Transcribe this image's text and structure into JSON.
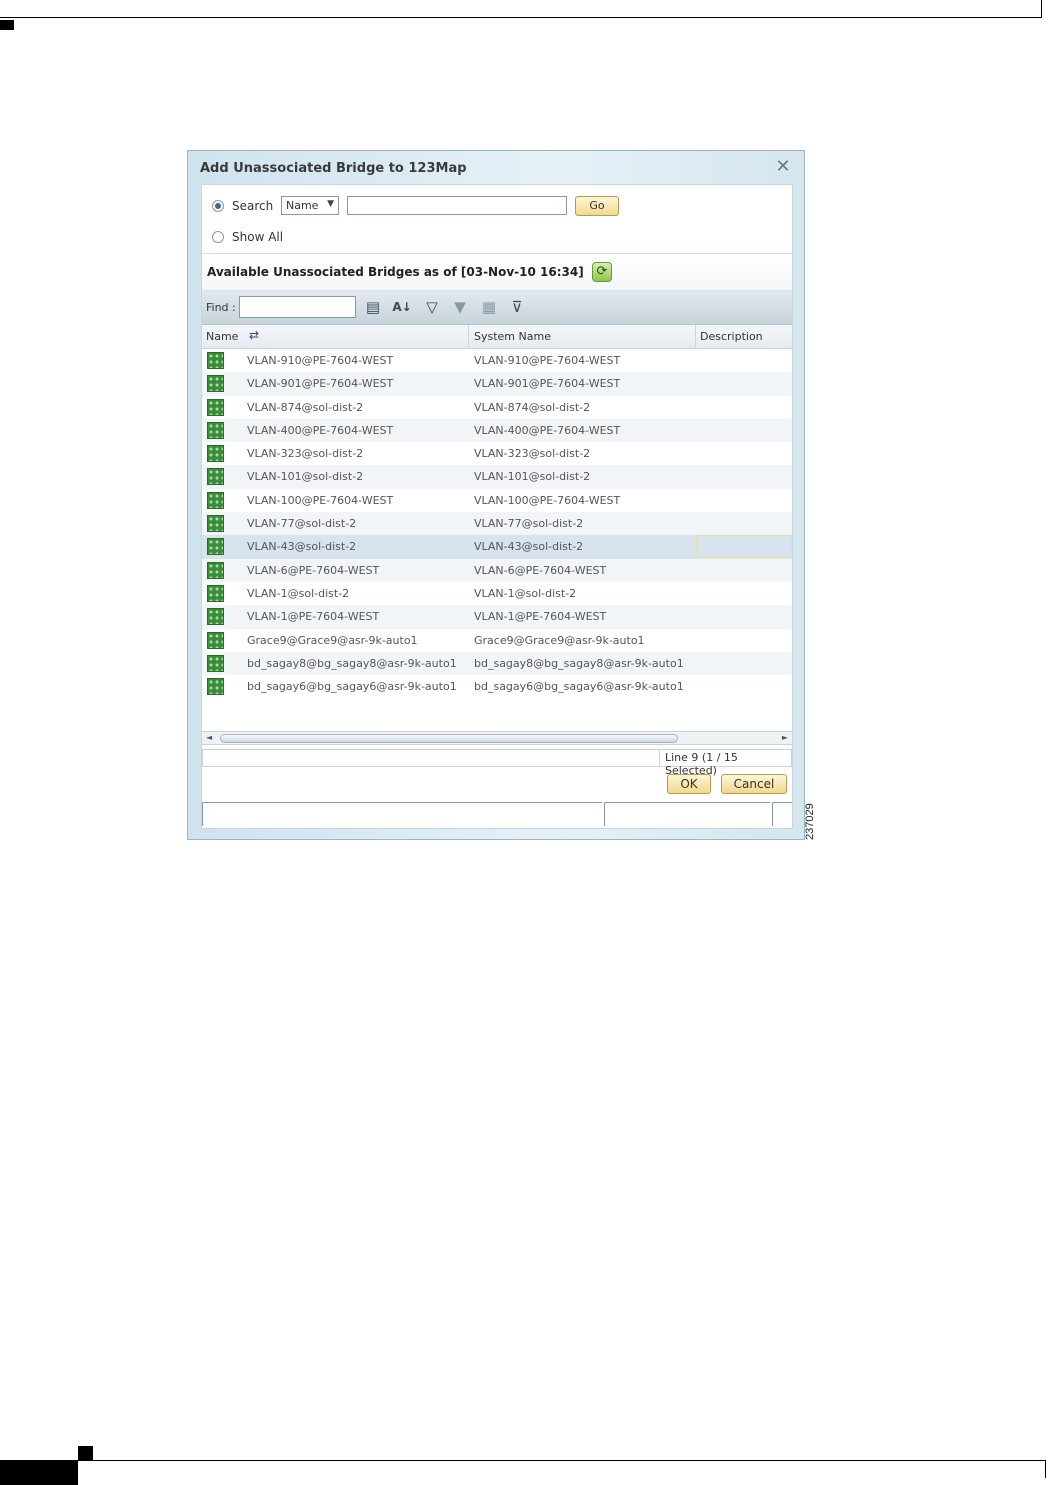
{
  "dialog": {
    "title": "Add Unassociated Bridge to 123Map",
    "close_icon": "close-icon"
  },
  "search": {
    "search_label": "Search",
    "show_all_label": "Show All",
    "selected_mode": "Search",
    "field_select": "Name",
    "query_value": "",
    "go_label": "Go"
  },
  "available": {
    "heading": "Available Unassociated Bridges as of [03-Nov-10 16:34]",
    "refresh_icon": "refresh-icon"
  },
  "toolbar": {
    "find_label": "Find :",
    "find_value": "",
    "icons": [
      "columns-icon",
      "sort-az-icon",
      "filter-icon",
      "advanced-filter-icon",
      "clear-filter-icon",
      "filter-settings-icon"
    ]
  },
  "table": {
    "columns": [
      "Name",
      "System Name",
      "Description"
    ],
    "rows": [
      {
        "name": "VLAN-910@PE-7604-WEST",
        "system_name": "VLAN-910@PE-7604-WEST",
        "description": ""
      },
      {
        "name": "VLAN-901@PE-7604-WEST",
        "system_name": "VLAN-901@PE-7604-WEST",
        "description": ""
      },
      {
        "name": "VLAN-874@sol-dist-2",
        "system_name": "VLAN-874@sol-dist-2",
        "description": ""
      },
      {
        "name": "VLAN-400@PE-7604-WEST",
        "system_name": "VLAN-400@PE-7604-WEST",
        "description": ""
      },
      {
        "name": "VLAN-323@sol-dist-2",
        "system_name": "VLAN-323@sol-dist-2",
        "description": ""
      },
      {
        "name": "VLAN-101@sol-dist-2",
        "system_name": "VLAN-101@sol-dist-2",
        "description": ""
      },
      {
        "name": "VLAN-100@PE-7604-WEST",
        "system_name": "VLAN-100@PE-7604-WEST",
        "description": ""
      },
      {
        "name": "VLAN-77@sol-dist-2",
        "system_name": "VLAN-77@sol-dist-2",
        "description": ""
      },
      {
        "name": "VLAN-43@sol-dist-2",
        "system_name": "VLAN-43@sol-dist-2",
        "description": ""
      },
      {
        "name": "VLAN-6@PE-7604-WEST",
        "system_name": "VLAN-6@PE-7604-WEST",
        "description": ""
      },
      {
        "name": "VLAN-1@sol-dist-2",
        "system_name": "VLAN-1@sol-dist-2",
        "description": ""
      },
      {
        "name": "VLAN-1@PE-7604-WEST",
        "system_name": "VLAN-1@PE-7604-WEST",
        "description": ""
      },
      {
        "name": "Grace9@Grace9@asr-9k-auto1",
        "system_name": "Grace9@Grace9@asr-9k-auto1",
        "description": ""
      },
      {
        "name": "bd_sagay8@bg_sagay8@asr-9k-auto1",
        "system_name": "bd_sagay8@bg_sagay8@asr-9k-auto1",
        "description": ""
      },
      {
        "name": "bd_sagay6@bg_sagay6@asr-9k-auto1",
        "system_name": "bd_sagay6@bg_sagay6@asr-9k-auto1",
        "description": ""
      }
    ],
    "selected_row": 9
  },
  "status": {
    "text": "Line 9 (1 / 15 Selected)"
  },
  "buttons": {
    "ok_label": "OK",
    "cancel_label": "Cancel"
  },
  "figure_id": "237029"
}
